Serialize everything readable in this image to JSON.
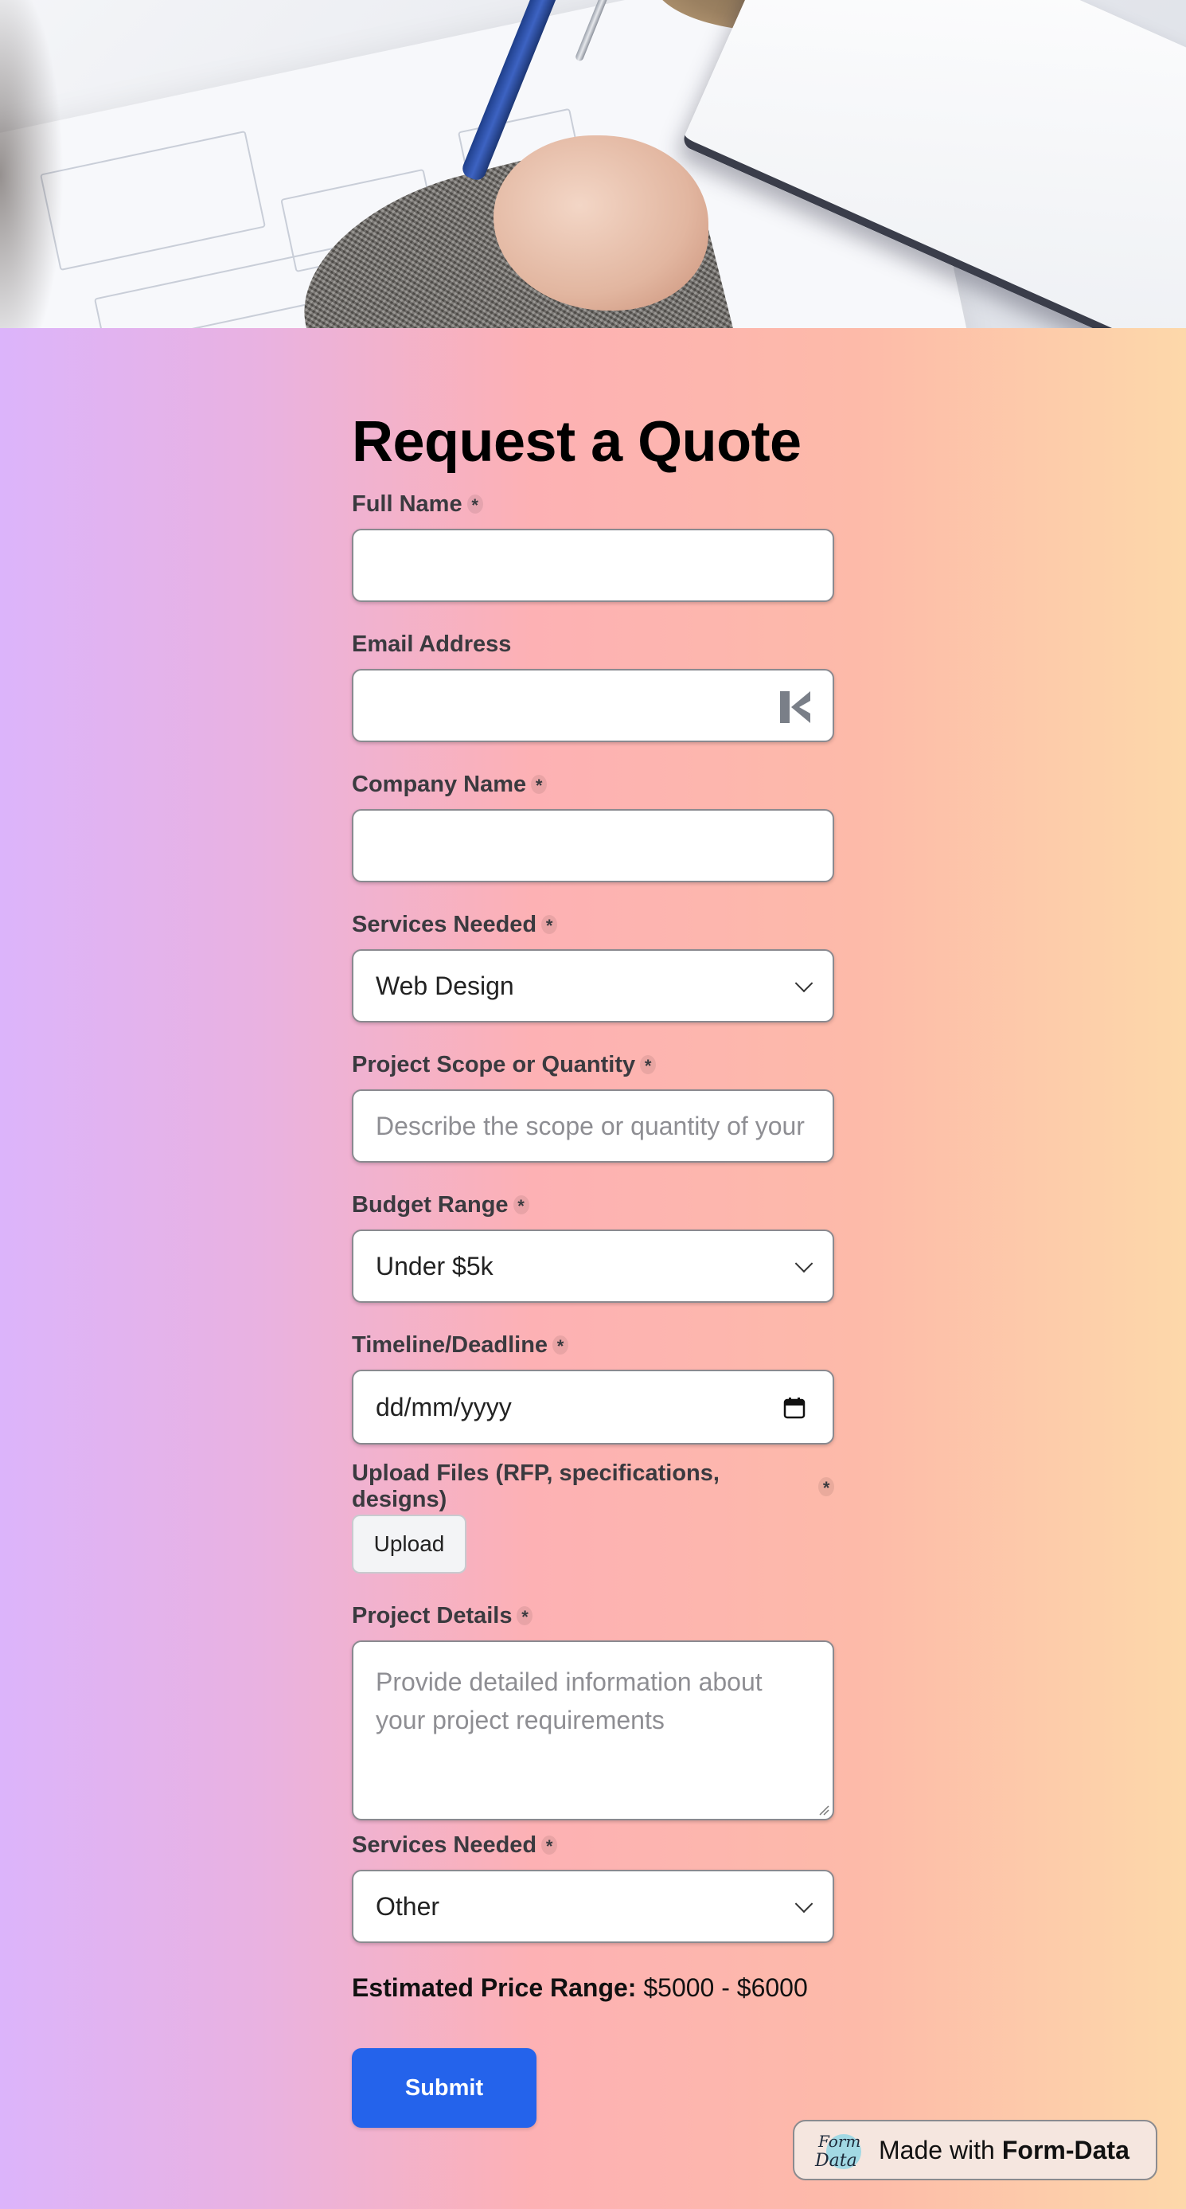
{
  "form": {
    "title": "Request a Quote",
    "fields": {
      "full_name": {
        "label": "Full Name",
        "required_mark": "*",
        "value": ""
      },
      "email": {
        "label": "Email Address",
        "value": ""
      },
      "company": {
        "label": "Company Name",
        "required_mark": "*",
        "value": ""
      },
      "services": {
        "label": "Services Needed",
        "required_mark": "*",
        "selected": "Web Design"
      },
      "scope": {
        "label": "Project Scope or Quantity",
        "required_mark": "*",
        "placeholder": "Describe the scope or quantity of your project"
      },
      "budget": {
        "label": "Budget Range",
        "required_mark": "*",
        "selected": "Under $5k"
      },
      "timeline": {
        "label": "Timeline/Deadline",
        "required_mark": "*",
        "placeholder": "dd/mm/yyyy"
      },
      "upload": {
        "label": "Upload Files (RFP, specifications, designs)",
        "required_mark": "*",
        "button_label": "Upload"
      },
      "details": {
        "label": "Project Details",
        "required_mark": "*",
        "placeholder": "Provide detailed information about your project requirements"
      },
      "services2": {
        "label": "Services Needed",
        "required_mark": "*",
        "selected": "Other"
      }
    },
    "price": {
      "label": "Estimated Price Range:",
      "value": "$5000 - $6000"
    },
    "submit_label": "Submit"
  },
  "badge": {
    "prefix": "Made with",
    "brand": "Form-Data",
    "logo_text": "Form Data"
  },
  "colors": {
    "accent": "#2463eb",
    "gradient_left": "#dcb4fb",
    "gradient_mid": "#fdb1b4",
    "gradient_right": "#fdd8aa"
  }
}
